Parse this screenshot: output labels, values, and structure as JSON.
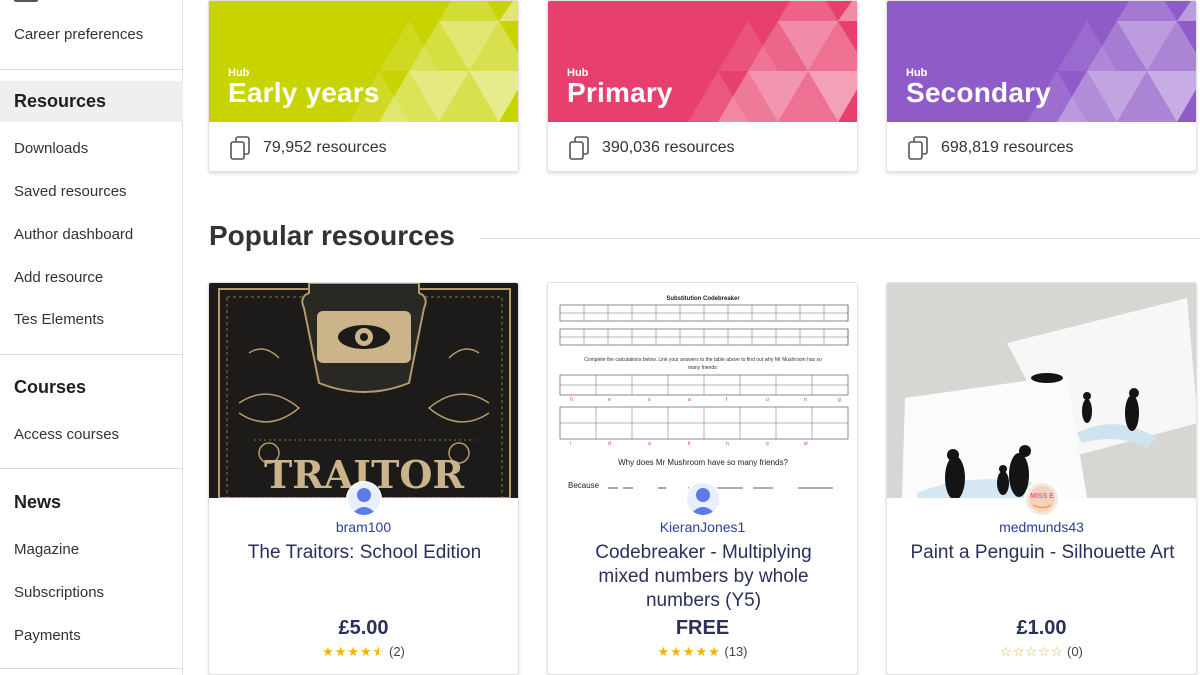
{
  "sidebar": {
    "career_preferences": "Career preferences",
    "resources_heading": "Resources",
    "resources_items": [
      "Downloads",
      "Saved resources",
      "Author dashboard",
      "Add resource",
      "Tes Elements"
    ],
    "courses_heading": "Courses",
    "courses_items": [
      "Access courses"
    ],
    "news_heading": "News",
    "news_items": [
      "Magazine",
      "Subscriptions",
      "Payments"
    ]
  },
  "hubs": [
    {
      "kicker": "Hub",
      "title": "Early years",
      "count": "79,952 resources",
      "color": "#c8d400"
    },
    {
      "kicker": "Hub",
      "title": "Primary",
      "count": "390,036 resources",
      "color": "#e8406e"
    },
    {
      "kicker": "Hub",
      "title": "Secondary",
      "count": "698,819 resources",
      "color": "#8f5bc9"
    }
  ],
  "popular": {
    "heading": "Popular resources",
    "cards": [
      {
        "author": "bram100",
        "title": "The Traitors: School Edition",
        "price": "£5.00",
        "rating_count": "(2)",
        "stars": 4.5,
        "thumb_text": "TRAITOR",
        "avatar_icon": "user-icon"
      },
      {
        "author": "KieranJones1",
        "title": "Codebreaker - Multiplying mixed numbers by whole numbers (Y5)",
        "price": "FREE",
        "rating_count": "(13)",
        "stars": 5,
        "thumb_text": "Substitution Codebreaker",
        "thumb_question": "Why does Mr Mushroom have so many friends?",
        "thumb_because": "Because",
        "avatar_icon": "user-icon"
      },
      {
        "author": "medmunds43",
        "title": "Paint a Penguin - Silhouette Art",
        "price": "£1.00",
        "rating_count": "(0)",
        "stars": 0,
        "avatar_text": "MISS E",
        "avatar_icon": "author-logo-icon"
      }
    ]
  },
  "colors": {
    "link": "#2d3e9b",
    "title": "#2a3158",
    "star": "#f5b301"
  }
}
